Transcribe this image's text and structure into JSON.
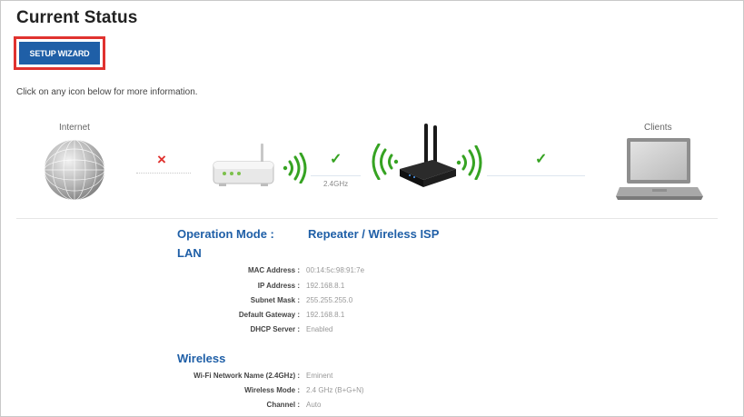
{
  "page": {
    "title": "Current Status",
    "hint": "Click on any icon below for more information."
  },
  "wizard": {
    "label": "SETUP WIZARD"
  },
  "topology": {
    "internet_label": "Internet",
    "clients_label": "Clients",
    "band_label": "2.4GHz",
    "internet_status": "×",
    "uplink_status": "✓",
    "client_status": "✓",
    "icons": [
      "globe-icon",
      "router-icon",
      "repeater-icon",
      "laptop-icon"
    ]
  },
  "status": {
    "operation_mode_label": "Operation Mode :",
    "operation_mode_value": "Repeater / Wireless ISP",
    "lan": {
      "title": "LAN",
      "fields": [
        {
          "label": "MAC Address :",
          "value": "00:14:5c:98:91:7e"
        },
        {
          "label": "IP Address :",
          "value": "192.168.8.1"
        },
        {
          "label": "Subnet Mask :",
          "value": "255.255.255.0"
        },
        {
          "label": "Default Gateway :",
          "value": "192.168.8.1"
        },
        {
          "label": "DHCP Server :",
          "value": "Enabled"
        }
      ]
    },
    "wireless": {
      "title": "Wireless",
      "fields": [
        {
          "label": "Wi-Fi Network Name (2.4GHz) :",
          "value": "Eminent"
        },
        {
          "label": "Wireless Mode :",
          "value": "2.4 GHz (B+G+N)"
        },
        {
          "label": "Channel :",
          "value": "Auto"
        }
      ]
    }
  },
  "colors": {
    "accent": "#1f5fa7",
    "error": "#e0322f",
    "ok": "#36a322",
    "wifi": "#36a322"
  }
}
